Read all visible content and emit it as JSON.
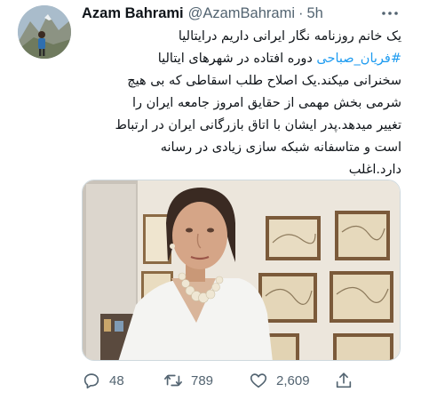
{
  "author": {
    "display_name": "Azam Bahrami",
    "handle": "@AzamBahrami",
    "separator": "·",
    "time": "5h"
  },
  "tweet": {
    "lines": [
      {
        "before": "",
        "hashtag": "",
        "after": "یک خانم روزنامه نگار ایرانی داریم درایتالیا"
      },
      {
        "before": "",
        "hashtag": "#فریان_صباحی",
        "after": " دوره افتاده در شهرهای ایتالیا"
      },
      {
        "before": "",
        "hashtag": "",
        "after": "سخنرانی میکند.یک اصلاح طلب اسقاطی که بی هیچ"
      },
      {
        "before": "",
        "hashtag": "",
        "after": "شرمی بخش مهمی از حقایق امروز جامعه ایران را"
      },
      {
        "before": "",
        "hashtag": "",
        "after": "تغییر میدهد.پدر ایشان با اتاق بازرگانی ایران در ارتباط"
      },
      {
        "before": "",
        "hashtag": "",
        "after": "است و متاسفانه شبکه سازی زیادی در رسانه"
      },
      {
        "before": "",
        "hashtag": "",
        "after": "دارد.اغلب"
      }
    ]
  },
  "actions": {
    "replies": "48",
    "retweets": "789",
    "likes": "2,609"
  },
  "icons": {
    "avatar": "avatar-photo",
    "more": "more-options-icon",
    "reply": "reply-icon",
    "retweet": "retweet-icon",
    "like": "heart-icon",
    "share": "share-icon"
  },
  "colors": {
    "text": "#0f1419",
    "secondary": "#536471",
    "link": "#1d9bf0"
  }
}
